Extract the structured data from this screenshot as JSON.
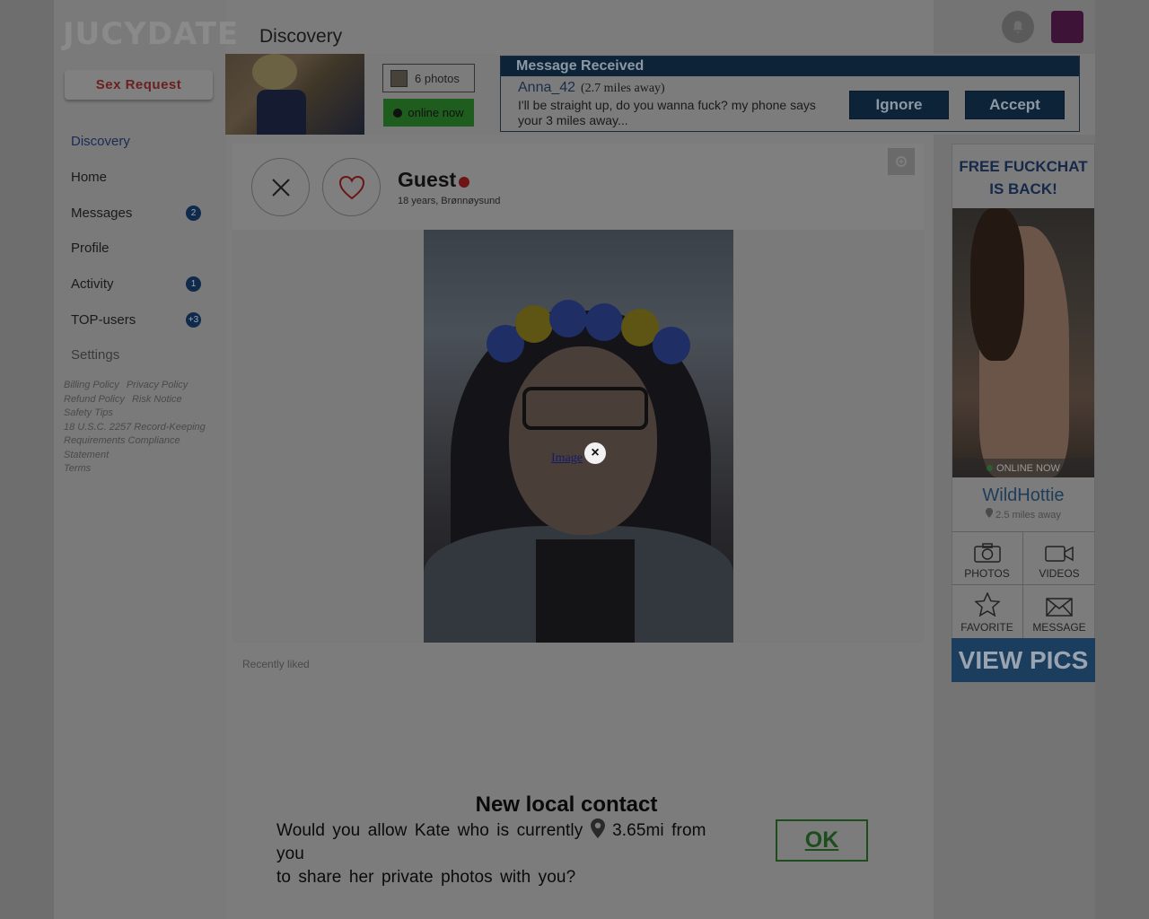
{
  "brand": {
    "logo": "JUCYDATE"
  },
  "sidebar": {
    "sex_request": "Sex Request",
    "items": [
      {
        "label": "Discovery",
        "badge": ""
      },
      {
        "label": "Home",
        "badge": ""
      },
      {
        "label": "Messages",
        "badge": "2"
      },
      {
        "label": "Profile",
        "badge": ""
      },
      {
        "label": "Activity",
        "badge": "1"
      },
      {
        "label": "TOP-users",
        "badge": "+3"
      },
      {
        "label": "Settings",
        "badge": ""
      }
    ],
    "legal": [
      "Billing Policy",
      "Privacy Policy",
      "Refund Policy",
      "Risk Notice",
      "Safety Tips",
      "18 U.S.C. 2257 Record-Keeping Requirements Compliance Statement",
      "Terms"
    ]
  },
  "header": {
    "title": "Discovery",
    "bell_icon": "bell-icon"
  },
  "notification": {
    "photos_label": "6 photos",
    "online_label": "online now",
    "heading": "Message Received",
    "sender": "Anna_42",
    "distance": "(2.7 miles away)",
    "text": "I'll be straight up, do you wanna fuck?  my phone says your 3 miles away...",
    "ignore": "Ignore",
    "accept": "Accept"
  },
  "profile": {
    "name": "Guest",
    "meta": "18 years, Brønnøysund",
    "image_label": "Image",
    "close_glyph": "×",
    "recently_liked": "Recently liked"
  },
  "ad": {
    "headline_1": "FREE FUCKCHAT",
    "headline_2": "IS BACK!",
    "online": "ONLINE NOW",
    "name": "WildHottie",
    "distance": "2.5 miles away",
    "photos": "PHOTOS",
    "videos": "VIDEOS",
    "favorite": "FAVORITE",
    "message": "MESSAGE",
    "cta": "VIEW PICS"
  },
  "local_contact": {
    "title": "New local contact",
    "text_1": "Would you allow Kate who is currently",
    "distance": "3.65mi from you",
    "text_2": "to share her private photos with you?",
    "ok": "OK"
  },
  "colors": {
    "overlay_bg": "#6e6e6e",
    "nav_accent": "#0f2a4a",
    "online_green": "#1e5d1e"
  }
}
